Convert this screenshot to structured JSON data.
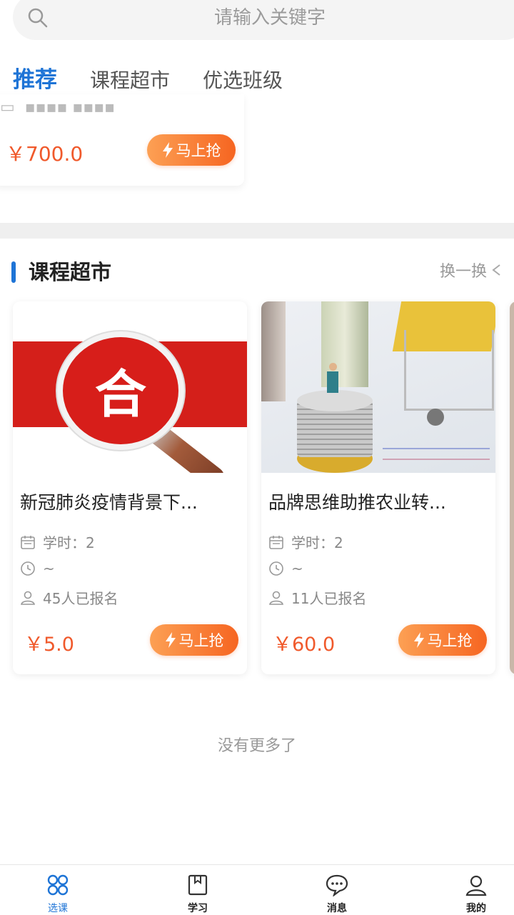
{
  "search": {
    "placeholder": "请输入关键字"
  },
  "tabs": [
    {
      "label": "推荐",
      "active": true
    },
    {
      "label": "课程超市",
      "active": false
    },
    {
      "label": "优选班级",
      "active": false
    }
  ],
  "partial_card": {
    "price": "￥700.0",
    "button": "马上抢"
  },
  "section": {
    "title": "课程超市",
    "refresh": "换一换"
  },
  "courses": [
    {
      "title": "新冠肺炎疫情背景下...",
      "hours": "学时：2",
      "time": "~",
      "enrolled": "45人已报名",
      "price": "￥5.0",
      "button": "马上抢",
      "badge": "合"
    },
    {
      "title": "品牌思维助推农业转...",
      "hours": "学时：2",
      "time": "~",
      "enrolled": "11人已报名",
      "price": "￥60.0",
      "button": "马上抢"
    }
  ],
  "footer": {
    "no_more": "没有更多了"
  },
  "bottom_nav": [
    {
      "label": "选课",
      "icon": "grid-icon",
      "active": true
    },
    {
      "label": "学习",
      "icon": "book-icon",
      "active": false
    },
    {
      "label": "消息",
      "icon": "chat-icon",
      "active": false
    },
    {
      "label": "我的",
      "icon": "user-icon",
      "active": false
    }
  ],
  "colors": {
    "accent": "#1e74d6",
    "price": "#f0592b",
    "button_start": "#fca054",
    "button_end": "#f66521"
  }
}
